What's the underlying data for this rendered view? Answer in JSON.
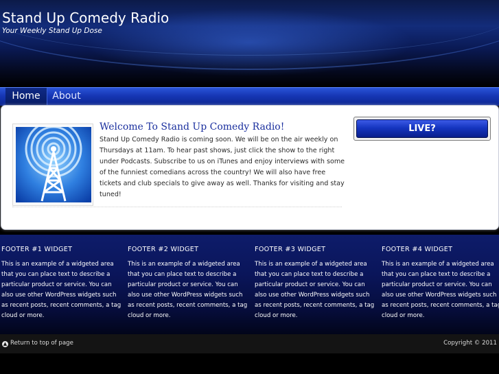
{
  "header": {
    "title": "Stand Up Comedy Radio",
    "description": "Your Weekly Stand Up Dose"
  },
  "nav": {
    "items": [
      {
        "label": "Home",
        "active": true
      },
      {
        "label": "About",
        "active": false
      }
    ]
  },
  "post": {
    "image_icon": "radio-tower-icon",
    "title": "Welcome To Stand Up Comedy Radio!",
    "body": "Stand Up Comedy Radio is coming soon.  We will be on the air weekly on Thursdays at 11am.  To hear past shows, just click the show to the right under Podcasts.  Subscribe to us on iTunes and enjoy interviews with some of the funniest comedians across the country!  We will also have free tickets and club specials to give away as well.  Thanks for visiting and stay tuned!"
  },
  "sidebar": {
    "live_label": "LIVE?"
  },
  "footer_widgets": [
    {
      "title": "FOOTER #1 WIDGET",
      "text": "This is an example of a widgeted area that you can place text to describe a particular product or service. You can also use other WordPress widgets such as recent posts, recent comments, a tag cloud or more."
    },
    {
      "title": "FOOTER #2 WIDGET",
      "text": "This is an example of a widgeted area that you can place text to describe a particular product or service. You can also use other WordPress widgets such as recent posts, recent comments, a tag cloud or more."
    },
    {
      "title": "FOOTER #3 WIDGET",
      "text": "This is an example of a widgeted area that you can place text to describe a particular product or service. You can also use other WordPress widgets such as recent posts, recent comments, a tag cloud or more."
    },
    {
      "title": "FOOTER #4 WIDGET",
      "text": "This is an example of a widgeted area that you can place text to describe a particular product or service. You can also use other WordPress widgets such as recent posts, recent comments, a tag cloud or more."
    }
  ],
  "bottom_bar": {
    "return_icon": "arrow-up-icon",
    "return_label": "Return to top of page",
    "copyright": "Copyright © 2011"
  },
  "colors": {
    "accent": "#1636b4",
    "post_title": "#1a2f9e",
    "footer_bg": "#0a155a"
  }
}
